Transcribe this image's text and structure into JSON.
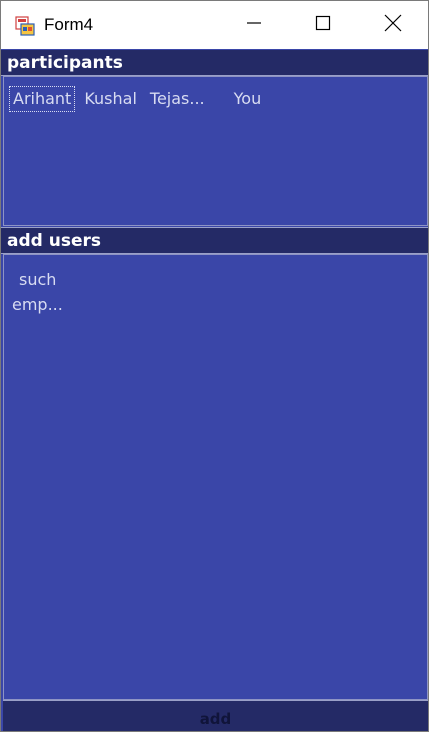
{
  "window": {
    "title": "Form4"
  },
  "participants": {
    "header": "participants",
    "items": [
      "Arihant",
      "Kushal",
      "Tejas...",
      "You"
    ],
    "selected": "Arihant"
  },
  "add_users": {
    "header": "add users",
    "items": [
      "such",
      "emp..."
    ]
  },
  "add_button": {
    "label": "add"
  },
  "colors": {
    "panel": "#3a46a8",
    "header": "#242a66",
    "text": "#d8dcf2"
  },
  "icons": [
    "app-icon",
    "minimize-icon",
    "maximize-icon",
    "close-icon"
  ]
}
